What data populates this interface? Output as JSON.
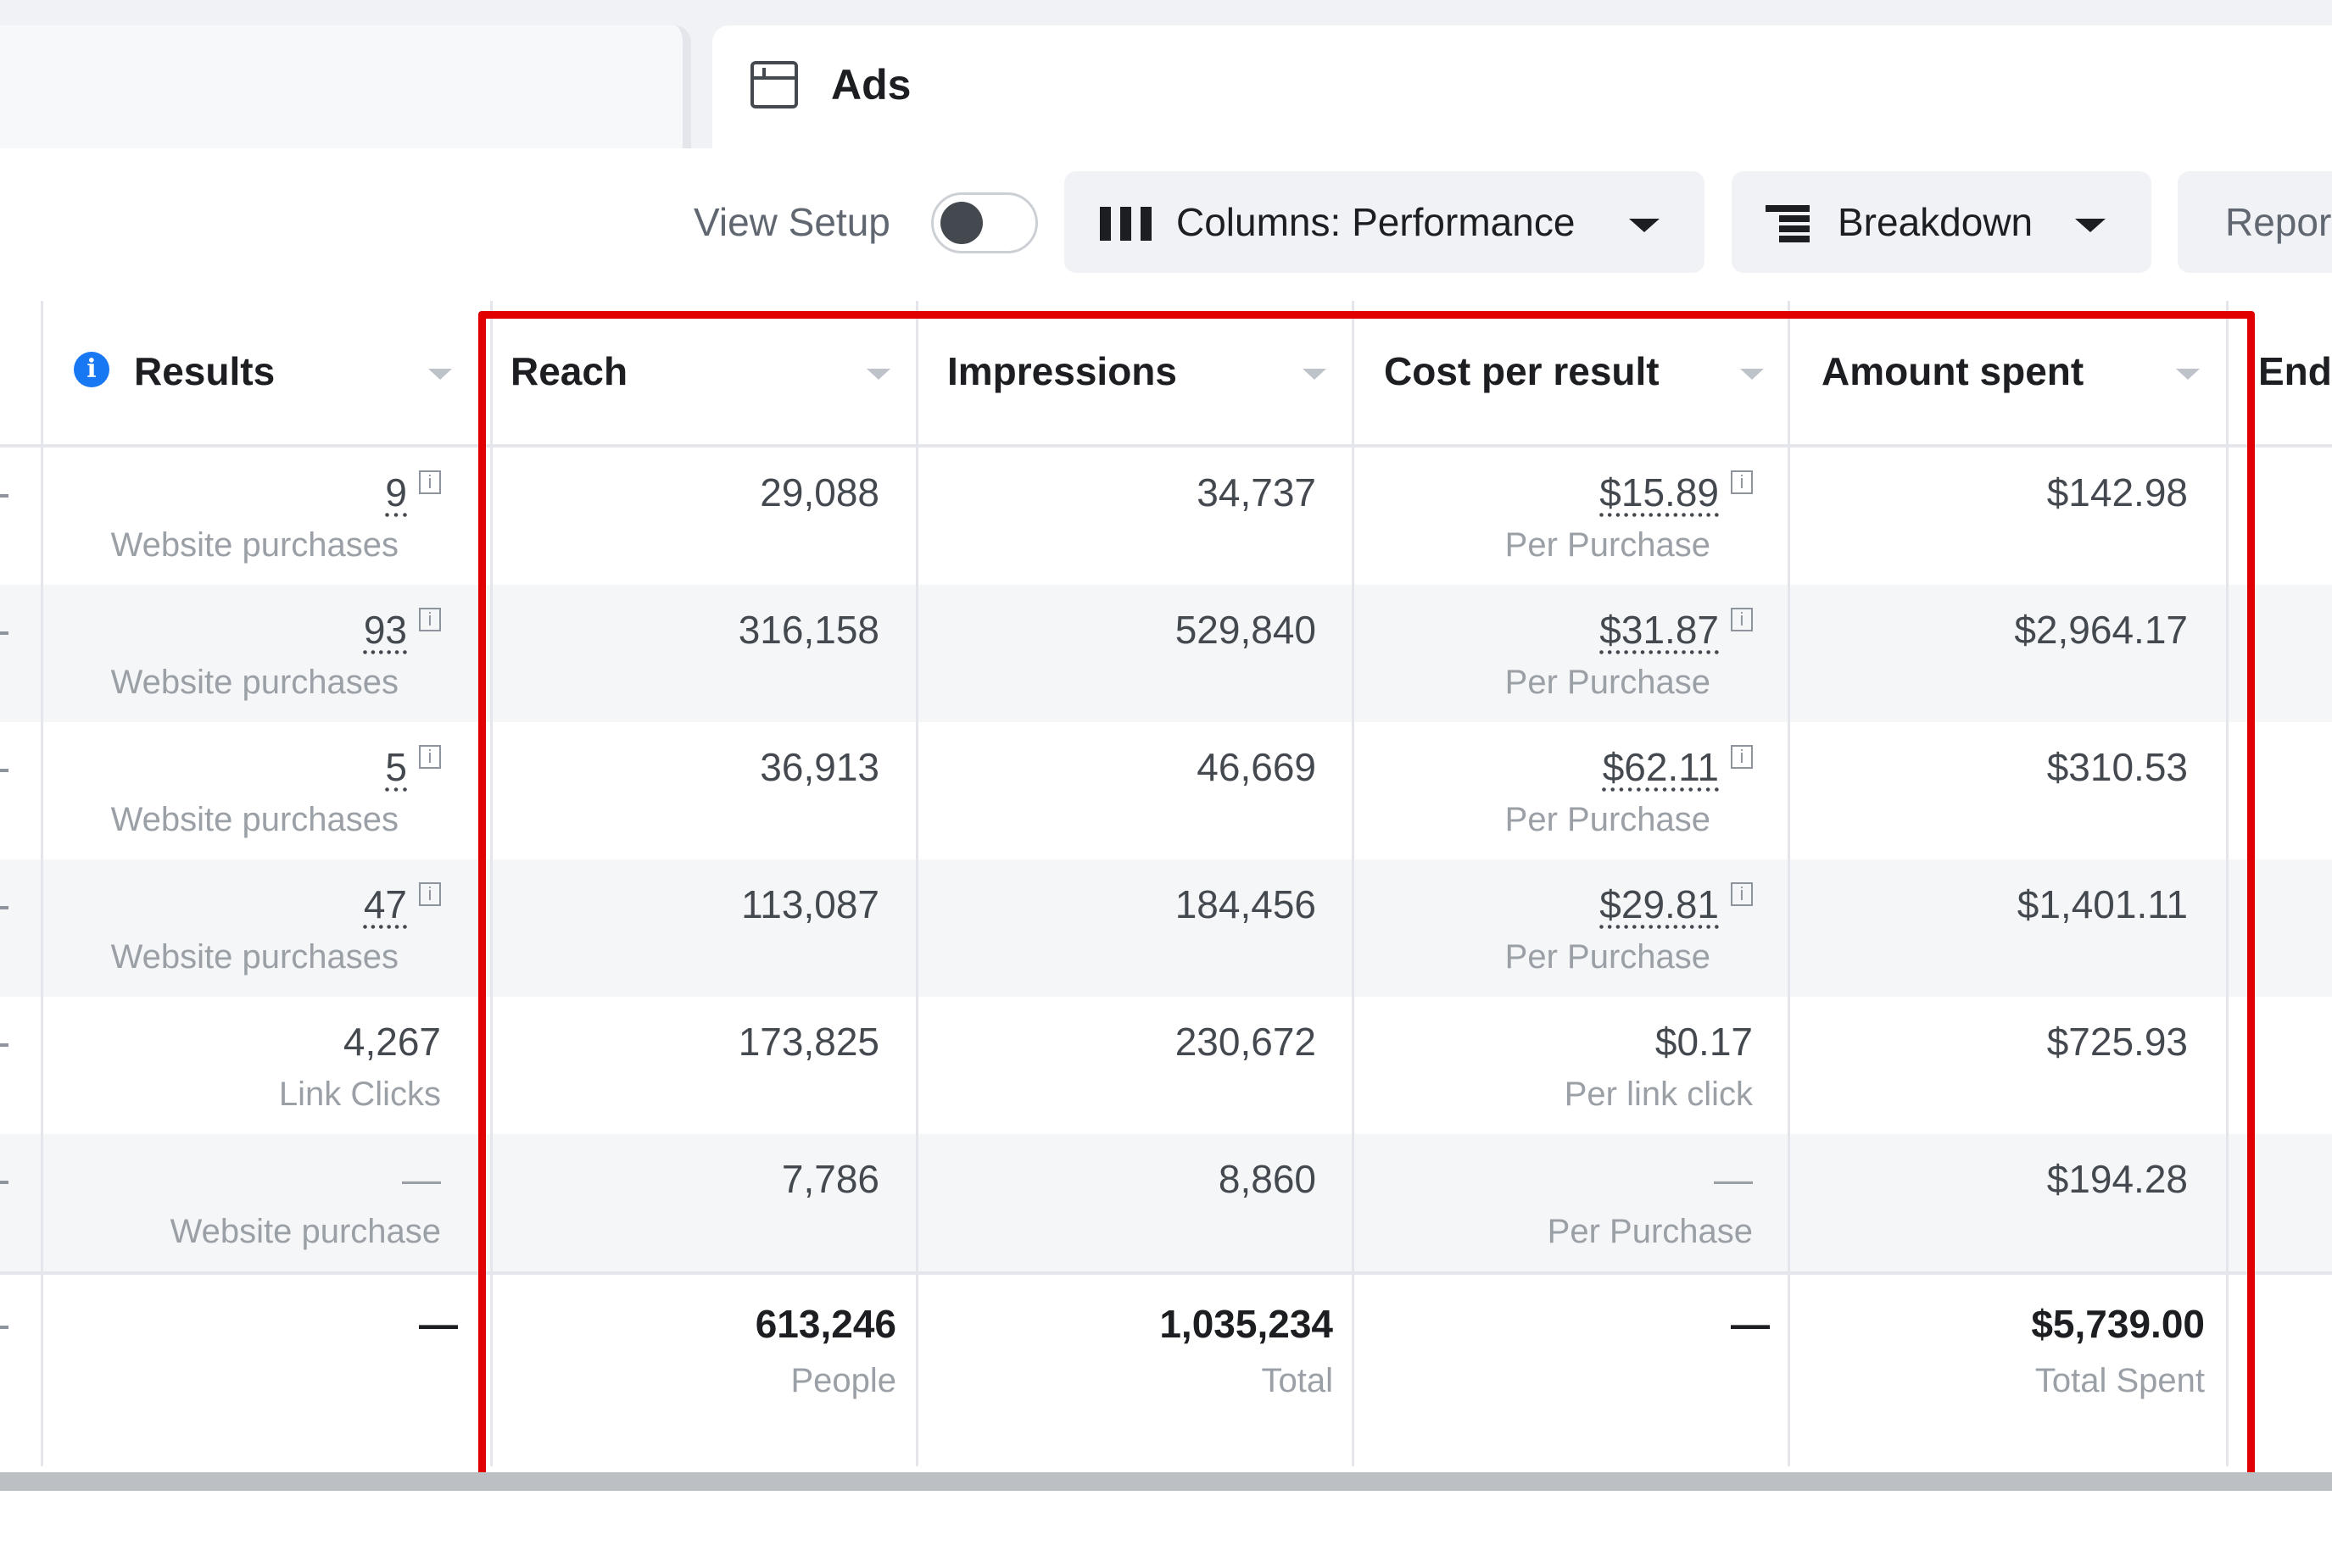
{
  "tab": {
    "icon": "ads-panel-icon",
    "label": "Ads"
  },
  "toolbar": {
    "view_setup_label": "View Setup",
    "view_setup_on": false,
    "columns_label": "Columns: Performance",
    "breakdown_label": "Breakdown",
    "reports_label": "Repor"
  },
  "table": {
    "headers": {
      "results": "Results",
      "reach": "Reach",
      "impressions": "Impressions",
      "cost_per_result": "Cost per result",
      "amount_spent": "Amount spent",
      "ends": "End"
    },
    "rows": [
      {
        "results": "9",
        "results_sub": "Website purchases",
        "reach": "29,088",
        "impressions": "34,737",
        "cost": "$15.89",
        "cost_sub": "Per Purchase",
        "spent": "$142.98"
      },
      {
        "results": "93",
        "results_sub": "Website purchases",
        "reach": "316,158",
        "impressions": "529,840",
        "cost": "$31.87",
        "cost_sub": "Per Purchase",
        "spent": "$2,964.17"
      },
      {
        "results": "5",
        "results_sub": "Website purchases",
        "reach": "36,913",
        "impressions": "46,669",
        "cost": "$62.11",
        "cost_sub": "Per Purchase",
        "spent": "$310.53"
      },
      {
        "results": "47",
        "results_sub": "Website purchases",
        "reach": "113,087",
        "impressions": "184,456",
        "cost": "$29.81",
        "cost_sub": "Per Purchase",
        "spent": "$1,401.11"
      },
      {
        "results": "4,267",
        "results_sub": "Link Clicks",
        "reach": "173,825",
        "impressions": "230,672",
        "cost": "$0.17",
        "cost_sub": "Per link click",
        "spent": "$725.93"
      },
      {
        "results": "—",
        "results_sub": "Website purchase",
        "reach": "7,786",
        "impressions": "8,860",
        "cost": "—",
        "cost_sub": "Per Purchase",
        "spent": "$194.28"
      }
    ],
    "totals": {
      "results": "—",
      "reach": "613,246",
      "reach_sub": "People",
      "impressions": "1,035,234",
      "impressions_sub": "Total",
      "cost": "—",
      "spent": "$5,739.00",
      "spent_sub": "Total Spent"
    }
  },
  "attribution_marker": "[i]",
  "highlight_color": "#e00000"
}
